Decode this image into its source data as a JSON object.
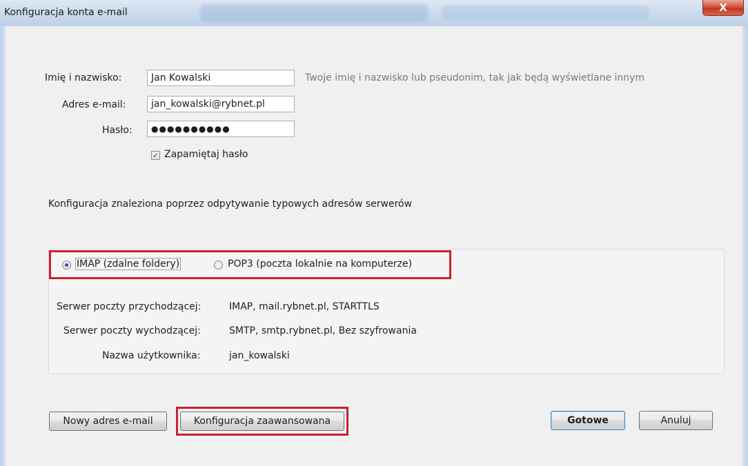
{
  "window": {
    "title": "Konfiguracja konta e-mail",
    "close_glyph": "X"
  },
  "form": {
    "name_label": "Imię i nazwisko:",
    "name_value": "Jan Kowalski",
    "name_hint": "Twoje imię i nazwisko lub pseudonim, tak jak będą wyświetlane innym",
    "email_label": "Adres e-mail:",
    "email_value": "jan_kowalski@rybnet.pl",
    "password_label": "Hasło:",
    "password_value": "●●●●●●●●●●",
    "remember_label": "Zapamiętaj hasło",
    "remember_checked": true
  },
  "status_text": "Konfiguracja znaleziona poprzez odpytywanie typowych adresów serwerów",
  "protocol": {
    "imap_label": "IMAP (zdalne foldery)",
    "pop3_label": "POP3 (poczta lokalnie na komputerze)",
    "selected": "IMAP"
  },
  "servers": {
    "incoming_label": "Serwer poczty przychodzącej:",
    "incoming_value": "IMAP, mail.rybnet.pl, STARTTLS",
    "outgoing_label": "Serwer poczty wychodzącej:",
    "outgoing_value": "SMTP, smtp.rybnet.pl, Bez szyfrowania",
    "username_label": "Nazwa użytkownika:",
    "username_value": "jan_kowalski"
  },
  "buttons": {
    "new_email": "Nowy adres e-mail",
    "advanced": "Konfiguracja zaawansowana",
    "done": "Gotowe",
    "cancel": "Anuluj"
  },
  "colors": {
    "highlight_red": "#c8202e",
    "radio_selected": "#2456a8"
  }
}
